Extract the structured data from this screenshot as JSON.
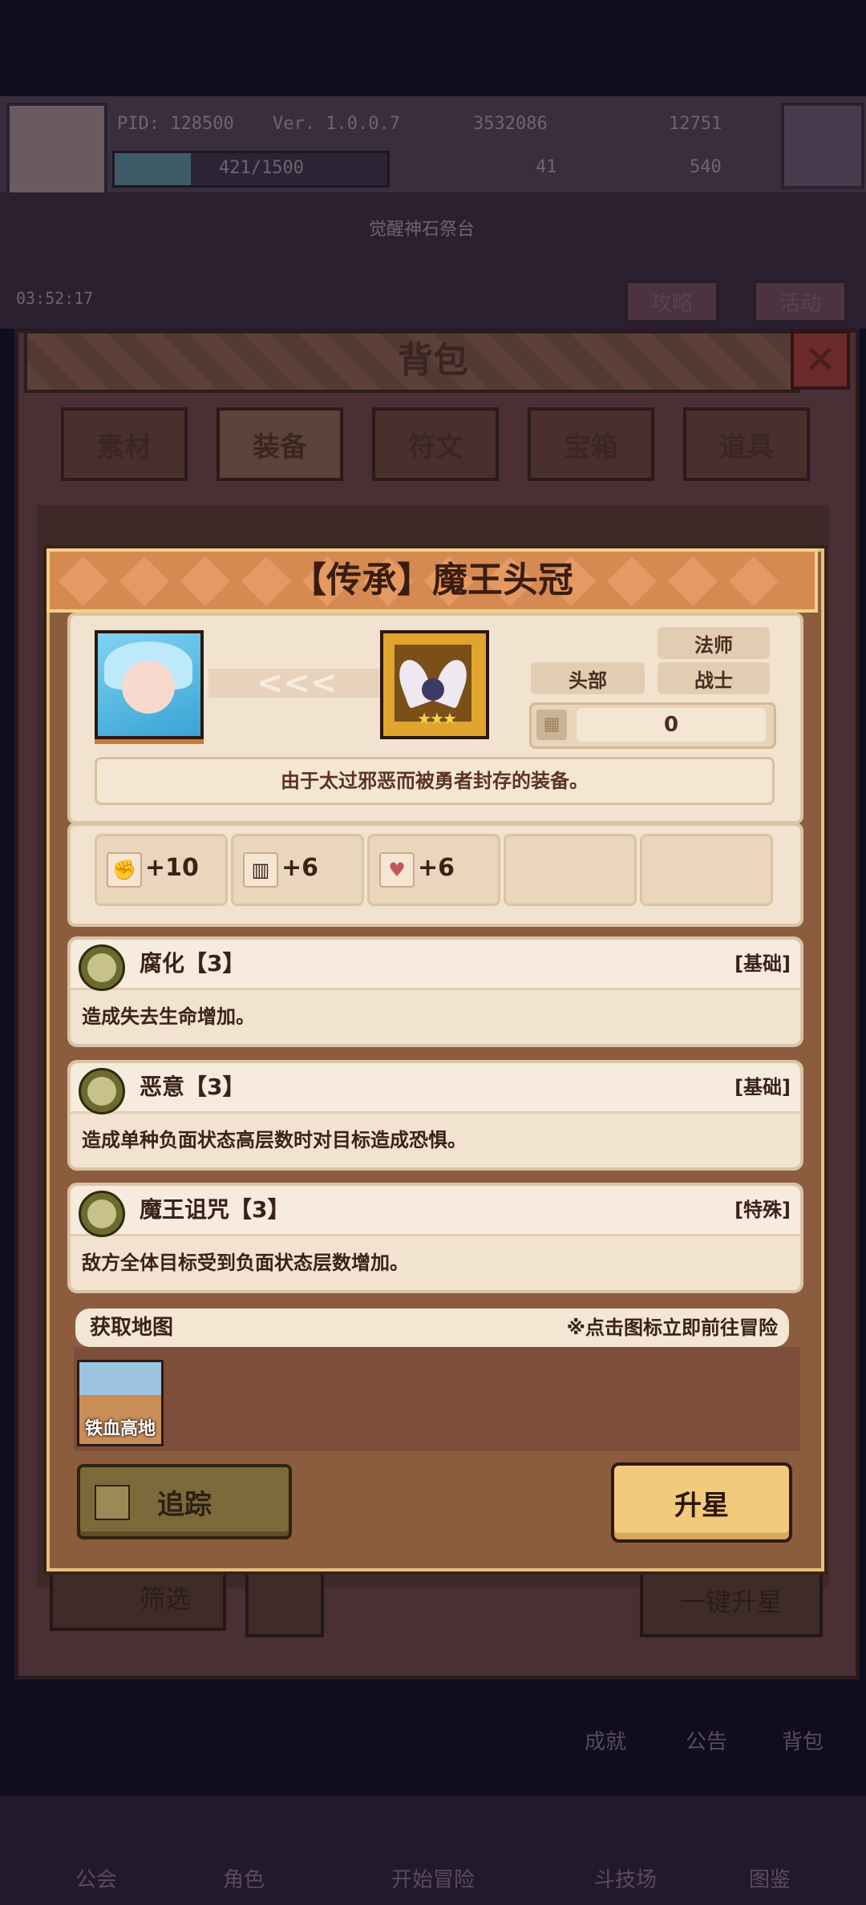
{
  "hud": {
    "pid": "PID: 128500",
    "version": "Ver. 1.0.0.7",
    "gold": "3532086",
    "gems": "12751",
    "energy": "421/1500",
    "energy_fraction": 0.28,
    "clover": "41",
    "key": "540",
    "timer": "03:52:17",
    "room_label": "觉醒神石祭台",
    "guide_label": "攻略",
    "event_label": "活动"
  },
  "backpack": {
    "title": "背包",
    "tabs": [
      "素材",
      "装备",
      "符文",
      "宝箱",
      "道具"
    ],
    "active_tab_index": 1,
    "filter_label": "筛选",
    "onekey_label": "一键升星"
  },
  "side_buttons": [
    "成就",
    "公告",
    "背包"
  ],
  "bottom_nav": [
    "公会",
    "角色",
    "开始冒险",
    "斗技场",
    "图鉴"
  ],
  "item": {
    "title": "【传承】魔王头冠",
    "arrows": "<<<",
    "slot": "头部",
    "classes": [
      "法师",
      "战士"
    ],
    "power": "0",
    "power_icon": "grid-icon",
    "description": "由于太过邪恶而被勇者封存的装备。",
    "stars": 3,
    "stats": [
      {
        "icon": "fist-icon",
        "value": "+10"
      },
      {
        "icon": "book-icon",
        "value": "+6"
      },
      {
        "icon": "heart-icon",
        "value": "+6"
      }
    ],
    "skills": [
      {
        "name": "腐化【3】",
        "type": "[基础]",
        "desc": "造成失去生命增加。",
        "icon": "corruption-skill-icon"
      },
      {
        "name": "恶意【3】",
        "type": "[基础]",
        "desc": "造成单种负面状态高层数时对目标造成恐惧。",
        "icon": "malice-skill-icon"
      },
      {
        "name": "魔王诅咒【3】",
        "type": "[特殊]",
        "desc": "敌方全体目标受到负面状态层数增加。",
        "icon": "moon-skill-icon"
      }
    ],
    "map_section_title": "获取地图",
    "map_hint": "※点击图标立即前往冒险",
    "maps": [
      {
        "name": "铁血高地"
      }
    ],
    "track_label": "追踪",
    "upgrade_label": "升星"
  },
  "colors": {
    "popup_header": "#d2844d",
    "popup_border": "#e6c27a",
    "card_bg": "#f1e3d0",
    "upgrade_button": "#f2ca7d",
    "track_button": "#7c6a3a"
  }
}
